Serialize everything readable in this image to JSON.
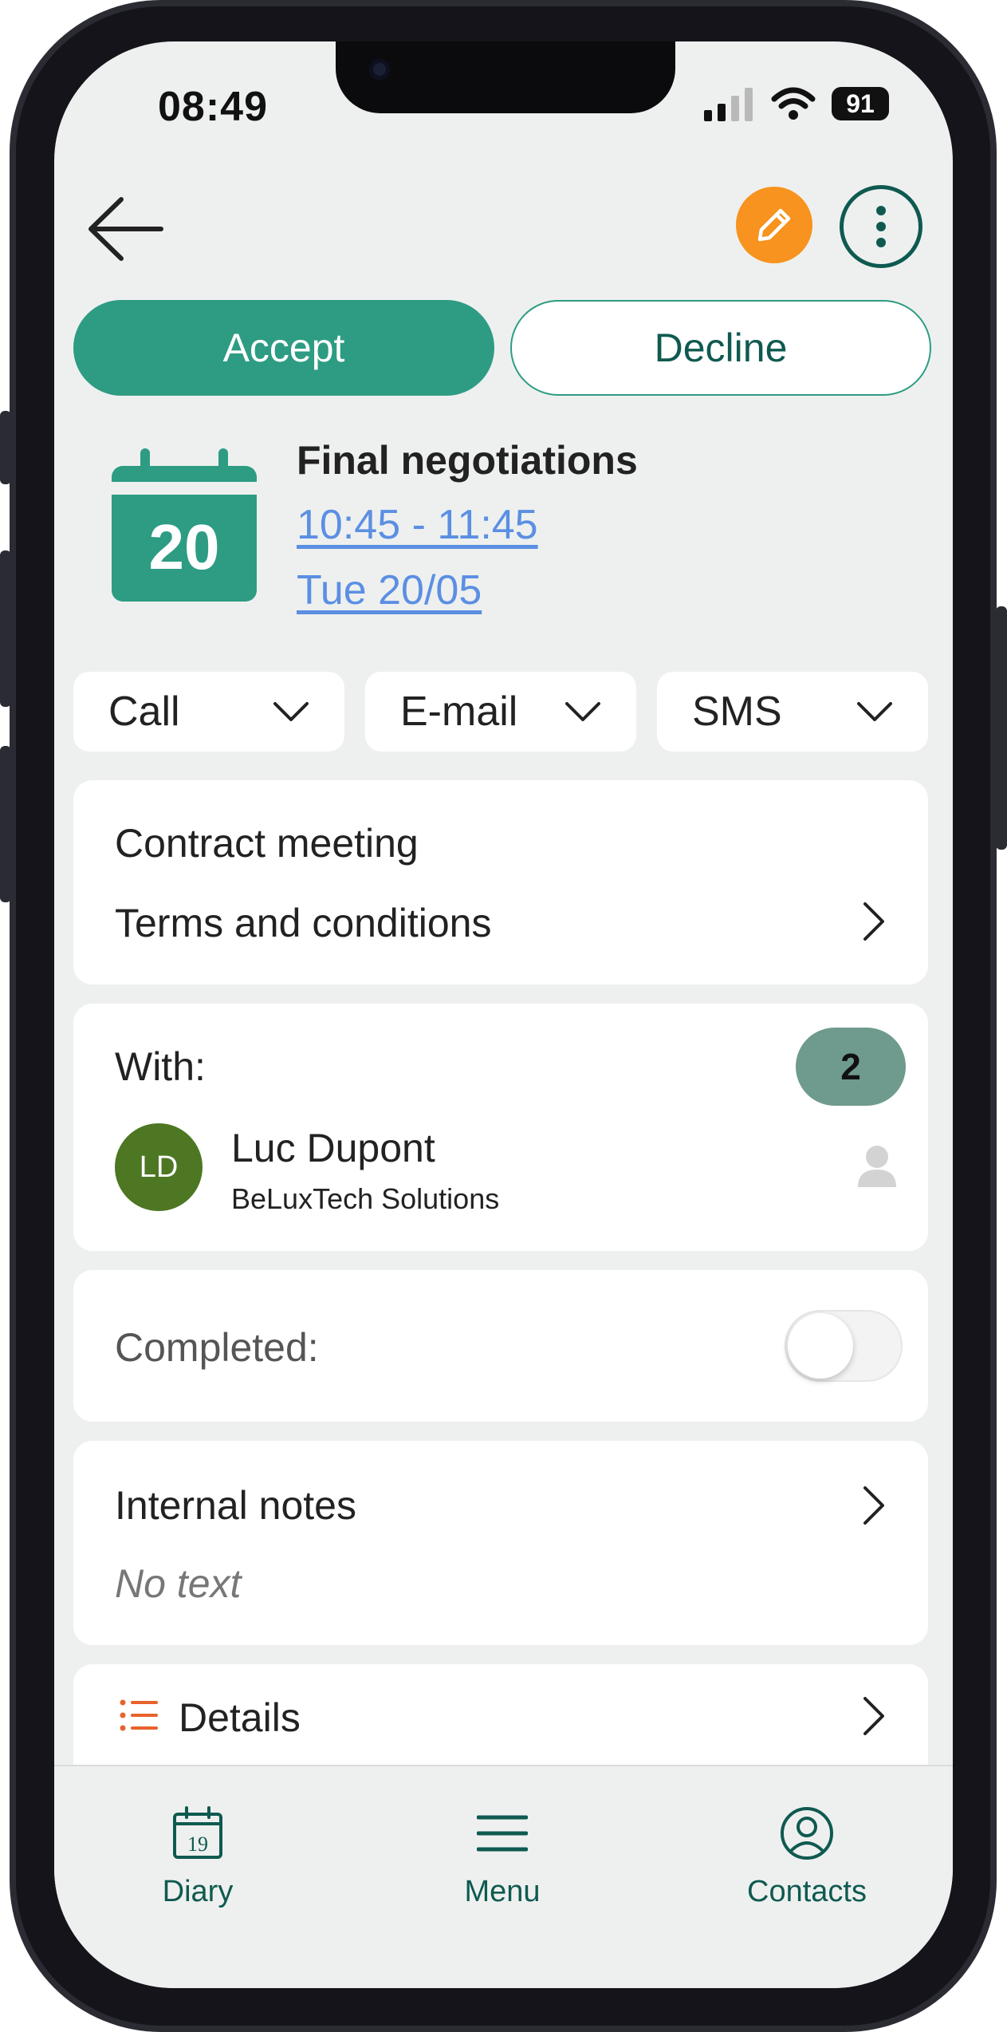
{
  "status_bar": {
    "time": "08:49",
    "battery": "91"
  },
  "header": {
    "back_icon": "arrow-left-icon",
    "edit_icon": "pencil-icon",
    "more_icon": "more-vertical-icon",
    "accent": "#f7931e"
  },
  "actions": {
    "accept_label": "Accept",
    "decline_label": "Decline",
    "primary_color": "#2d9c83"
  },
  "event": {
    "calendar_day": "20",
    "title": "Final negotiations",
    "time_range": "10:45 - 11:45",
    "date": "Tue 20/05"
  },
  "contact_actions": [
    {
      "label": "Call"
    },
    {
      "label": "E-mail"
    },
    {
      "label": "SMS"
    }
  ],
  "subject": {
    "type": "Contract meeting",
    "topic": "Terms and conditions"
  },
  "participants": {
    "label": "With:",
    "count": "2",
    "items": [
      {
        "initials": "LD",
        "name": "Luc Dupont",
        "company": "BeLuxTech Solutions"
      }
    ]
  },
  "completed": {
    "label": "Completed:",
    "value": false
  },
  "notes": {
    "title": "Internal notes",
    "value": "No text"
  },
  "details": {
    "title": "Details"
  },
  "tabbar": {
    "items": [
      {
        "label": "Diary",
        "icon": "calendar-icon",
        "icon_text": "19"
      },
      {
        "label": "Menu",
        "icon": "menu-icon"
      },
      {
        "label": "Contacts",
        "icon": "user-circle-icon"
      }
    ]
  }
}
